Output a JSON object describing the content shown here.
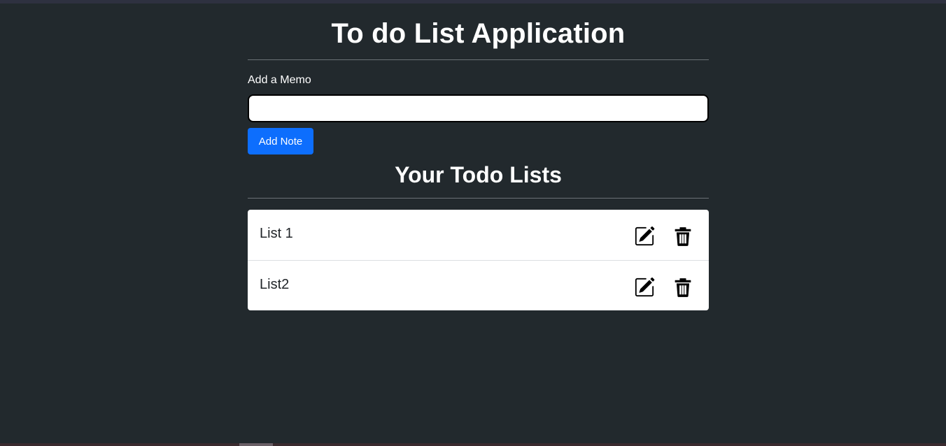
{
  "app": {
    "title": "To do List Application"
  },
  "memo_form": {
    "label": "Add a Memo",
    "input_value": "",
    "input_placeholder": "",
    "add_button_label": "Add Note",
    "add_button_color": "#0d6efd"
  },
  "lists_section": {
    "title": "Your Todo Lists",
    "items": [
      {
        "label": "List 1",
        "edit_icon": "pencil-square-icon",
        "delete_icon": "trash-icon"
      },
      {
        "label": "List2",
        "edit_icon": "pencil-square-icon",
        "delete_icon": "trash-icon"
      }
    ]
  },
  "colors": {
    "background": "#22292d",
    "card": "#ffffff",
    "text_dark": "#212529"
  }
}
